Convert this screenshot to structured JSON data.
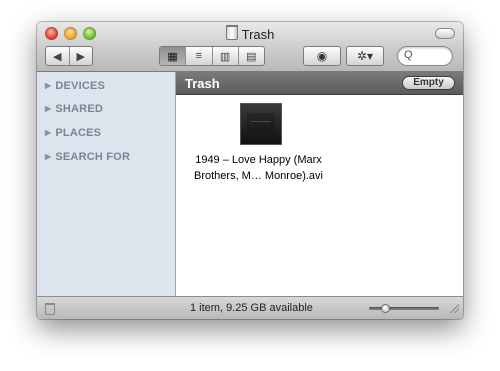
{
  "window": {
    "title": "Trash"
  },
  "toolbar": {
    "back_glyph": "◀",
    "forward_glyph": "▶",
    "view_glyphs": [
      "▦",
      "≡",
      "▥",
      "▤"
    ],
    "quicklook_glyph": "◉",
    "action_glyph": "✲▾",
    "search": {
      "icon": "Q",
      "value": "",
      "placeholder": ""
    }
  },
  "sidebar": {
    "items": [
      {
        "label": "DEVICES"
      },
      {
        "label": "SHARED"
      },
      {
        "label": "PLACES"
      },
      {
        "label": "SEARCH FOR"
      }
    ]
  },
  "pathbar": {
    "title": "Trash",
    "empty_label": "Empty"
  },
  "files": [
    {
      "name_line1": "1949 – Love Happy (Marx",
      "name_line2": "Brothers, M… Monroe).avi"
    }
  ],
  "status": {
    "text": "1 item, 9.25 GB available",
    "zoom_slider_value": 0.2
  },
  "colors": {
    "sidebar_bg": "#dde4ed",
    "pathbar_bg": "#666666"
  }
}
